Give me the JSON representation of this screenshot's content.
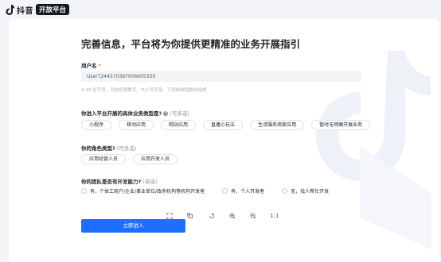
{
  "brand": {
    "name": "抖音",
    "badge": "开放平台"
  },
  "title": "完善信息，平台将为你提供更精准的业务开展指引",
  "username": {
    "label": "用户名",
    "required_mark": "*",
    "value": "User7244570367006605350",
    "tip": "4-25 位字符，可由任意数字、大小写字母、下划线或短横线组成"
  },
  "business_type": {
    "label": "你进入平台开展的具体业务类型是?",
    "hint": "(可多选)",
    "options": [
      "小程序",
      "移动应用",
      "网站应用",
      "直播小玩法",
      "生活服务商家应用",
      "暂时无明确开展业务"
    ]
  },
  "role": {
    "label": "你的角色类型?",
    "hint": "(可多选)",
    "options": [
      "应用经营人员",
      "应用开发人员"
    ]
  },
  "dev_ability": {
    "label": "你的团队是否有开发能力?",
    "hint": "(单选)",
    "options": [
      "有，个体工商户/企业/事业单位/政务机构等机构开发者",
      "有，个人开发者",
      "无，找人帮忙开发"
    ]
  },
  "submit_label": "立即进入",
  "toolbar": {
    "zoom_ratio": "1:1"
  },
  "colors": {
    "primary": "#1e6fff",
    "required": "#f54a45"
  }
}
